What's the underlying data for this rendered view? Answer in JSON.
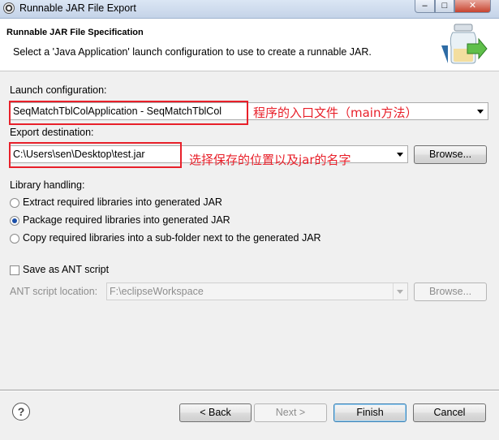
{
  "window": {
    "title": "Runnable JAR File Export",
    "minimize": "–",
    "maximize": "□",
    "close": "✕"
  },
  "header": {
    "title": "Runnable JAR File Specification",
    "description": "Select a 'Java Application' launch configuration to use to create a runnable JAR."
  },
  "launch": {
    "label": "Launch configuration:",
    "value": "SeqMatchTblColApplication - SeqMatchTblCol",
    "annotation": "程序的入口文件（main方法）"
  },
  "export": {
    "label": "Export destination:",
    "value": "C:\\Users\\sen\\Desktop\\test.jar",
    "annotation": "选择保存的位置以及jar的名字",
    "browse": "Browse..."
  },
  "library": {
    "label": "Library handling:",
    "options": [
      {
        "label": "Extract required libraries into generated JAR",
        "selected": false
      },
      {
        "label": "Package required libraries into generated JAR",
        "selected": true
      },
      {
        "label": "Copy required libraries into a sub-folder next to the generated JAR",
        "selected": false
      }
    ]
  },
  "ant": {
    "save_label": "Save as ANT script",
    "checked": false,
    "location_label": "ANT script location:",
    "location_value": "F:\\eclipseWorkspace",
    "browse": "Browse..."
  },
  "buttons": {
    "back": "< Back",
    "next": "Next >",
    "finish": "Finish",
    "cancel": "Cancel",
    "help": "?"
  },
  "colors": {
    "annotation": "#e8202a",
    "header_bg": "#ffffff",
    "dialog_bg": "#f0f0f0"
  }
}
